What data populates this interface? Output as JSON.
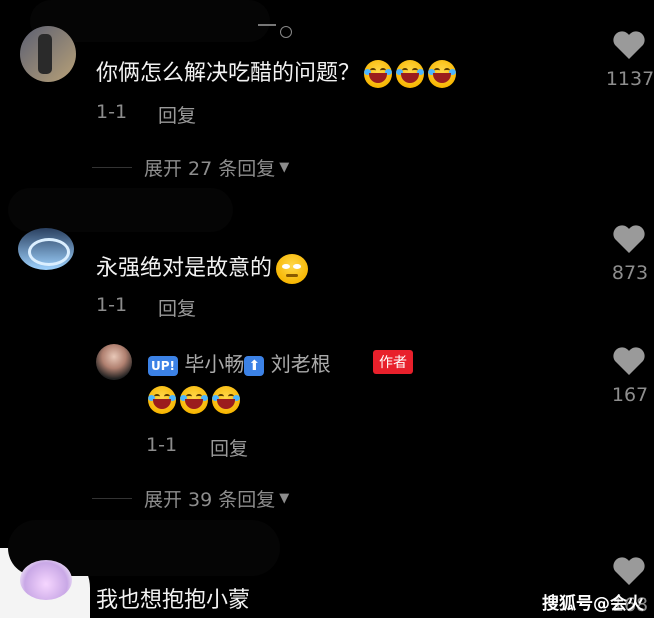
{
  "comments": [
    {
      "text": "你俩怎么解决吃醋的问题？",
      "date": "1-1",
      "reply_label": "回复",
      "likes": "1137",
      "expand_label": "展开 27 条回复"
    },
    {
      "text": "永强绝对是故意的",
      "date": "1-1",
      "reply_label": "回复",
      "likes": "873"
    },
    {
      "text": "我也想抱抱小蒙",
      "likes": "168"
    }
  ],
  "reply": {
    "up_badge": "UP!",
    "author_name": "毕小畅",
    "arrow": "⬆",
    "target_name": "刘老根",
    "author_tag": "作者",
    "date": "1-1",
    "reply_label": "回复",
    "likes": "167",
    "expand_label": "展开 39 条回复"
  },
  "watermark": "搜狐号@会火",
  "icons": {
    "like": "heart-icon",
    "expand": "triangle-down-icon",
    "emoji_laugh": "rofl-emoji-icon",
    "emoji_sneaky": "smirk-emoji-icon"
  },
  "colors": {
    "background": "#000000",
    "author_tag": "#e8202b",
    "up_badge": "#3c82e6"
  }
}
